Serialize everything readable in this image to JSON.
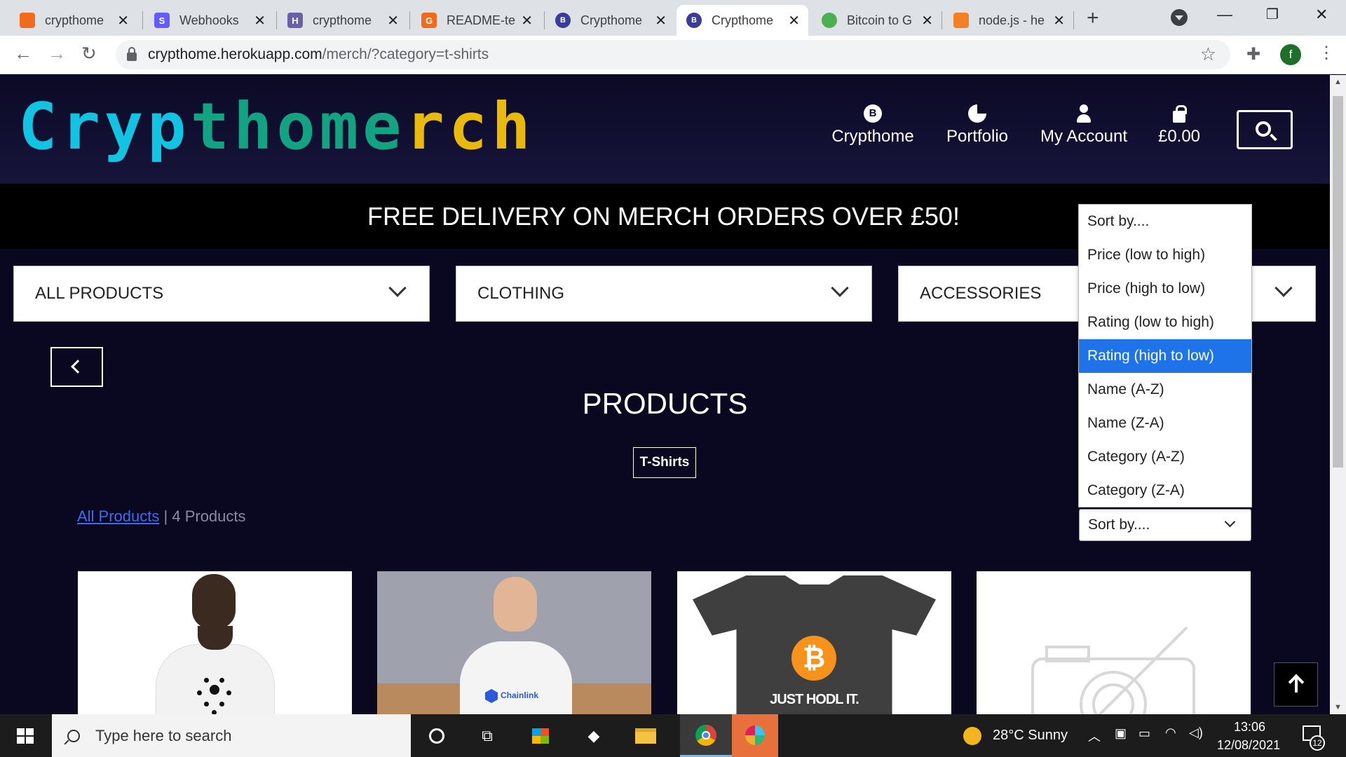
{
  "browser": {
    "tabs": [
      {
        "title": "crypthome",
        "favicon_color": "#f26b1d",
        "favicon_glyph": ""
      },
      {
        "title": "Webhooks",
        "favicon_color": "#635bff",
        "favicon_glyph": "S"
      },
      {
        "title": "crypthome",
        "favicon_color": "#6762a6",
        "favicon_glyph": "H"
      },
      {
        "title": "README-te",
        "favicon_color": "#f26b1d",
        "favicon_glyph": "G"
      },
      {
        "title": "Crypthome",
        "favicon_color": "#3b3b9a",
        "favicon_glyph": "B"
      },
      {
        "title": "Crypthome",
        "favicon_color": "#3b3b9a",
        "favicon_glyph": "B"
      },
      {
        "title": "Bitcoin to G",
        "favicon_color": "#4caf50",
        "favicon_glyph": ""
      },
      {
        "title": "node.js - he",
        "favicon_color": "#f48024",
        "favicon_glyph": ""
      }
    ],
    "active_tab_index": 5,
    "new_tab_label": "+",
    "url_domain": "crypthome.herokuapp.com",
    "url_path": "/merch/?category=t-shirts",
    "profile_initial": "f"
  },
  "site": {
    "logo": {
      "part1": "Cryp",
      "part2": "thome",
      "part3": "rch",
      "part2b": "me"
    },
    "nav": [
      {
        "label": "Crypthome",
        "icon": "bitcoin-coin-icon"
      },
      {
        "label": "Portfolio",
        "icon": "pie-chart-icon"
      },
      {
        "label": "My Account",
        "icon": "user-icon"
      },
      {
        "label": "£0.00",
        "icon": "shopping-bag-icon"
      }
    ],
    "coin_glyph": "B",
    "banner": "FREE DELIVERY ON MERCH ORDERS OVER £50!",
    "categories": [
      "ALL PRODUCTS",
      "CLOTHING",
      "ACCESSORIES"
    ],
    "products_title": "PRODUCTS",
    "active_tag": "T-Shirts",
    "breadcrumb_link": "All Products",
    "breadcrumb_sep": " | ",
    "product_count": "4 Products",
    "sort": {
      "current": "Sort by....",
      "options": [
        "Sort by....",
        "Price (low to high)",
        "Price (high to low)",
        "Rating (low to high)",
        "Rating (high to low)",
        "Name (A-Z)",
        "Name (Z-A)",
        "Category (A-Z)",
        "Category (Z-A)"
      ],
      "highlighted_index": 4
    },
    "product_cards": [
      {
        "image": "man-in-white-cardano-tshirt"
      },
      {
        "image": "man-in-white-chainlink-tshirt",
        "shirt_text": "Chainlink"
      },
      {
        "image": "grey-bitcoin-tshirt",
        "shirt_text": "JUST HODL IT.",
        "coin_glyph": "₿"
      },
      {
        "image": "no-image-placeholder-icon"
      }
    ],
    "colors": {
      "bg": "#0a0820",
      "logo_cyan": "#10c4e2",
      "logo_green": "#12a383",
      "logo_yellow": "#e9b90c",
      "highlight": "#1e73e8",
      "link": "#3c6df0"
    }
  },
  "taskbar": {
    "search_placeholder": "Type here to search",
    "weather": "28°C  Sunny",
    "time": "13:06",
    "date": "12/08/2021",
    "notification_count": "12"
  }
}
